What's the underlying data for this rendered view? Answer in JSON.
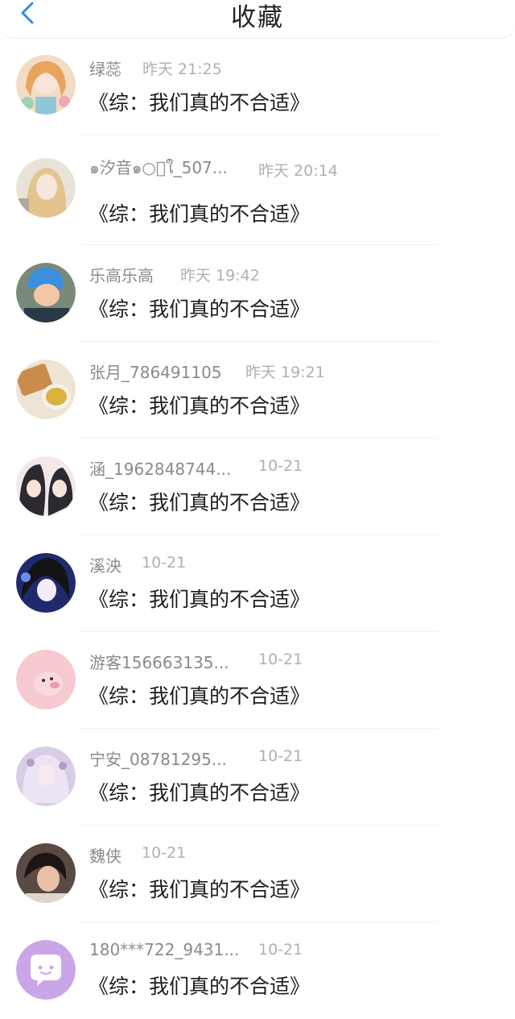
{
  "header": {
    "title": "收藏"
  },
  "colors": {
    "accent": "#2f8cf0",
    "username": "#8a8a8a",
    "time": "#b0b0b0"
  },
  "items": [
    {
      "username": "绿蕊",
      "time": "昨天 21:25",
      "title": "《综：我们真的不合适》",
      "avatar": "anime-girl-flowers"
    },
    {
      "username": "๑汐音๑○ฺใ_507...",
      "time": "昨天 20:14",
      "title": "《综：我们真的不合适》",
      "avatar": "blonde-girl"
    },
    {
      "username": "乐高乐高",
      "time": "昨天 19:42",
      "title": "《综：我们真的不合适》",
      "avatar": "baby-blue-hat"
    },
    {
      "username": "张月_786491105",
      "time": "昨天 19:21",
      "title": "《综：我们真的不合适》",
      "avatar": "tea-and-snack"
    },
    {
      "username": "涵_1962848744...",
      "time": "10-21",
      "title": "《综：我们真的不合适》",
      "avatar": "anime-couple"
    },
    {
      "username": "溪泱",
      "time": "10-21",
      "title": "《综：我们真的不合适》",
      "avatar": "anime-dark-hair"
    },
    {
      "username": "游客156663135...",
      "time": "10-21",
      "title": "《综：我们真的不合适》",
      "avatar": "pink-pig"
    },
    {
      "username": "宁安_08781295...",
      "time": "10-21",
      "title": "《综：我们真的不合适》",
      "avatar": "lace-girl"
    },
    {
      "username": "魏侠",
      "time": "10-21",
      "title": "《综：我们真的不合适》",
      "avatar": "woman-photo"
    },
    {
      "username": "180***722_9431...",
      "time": "10-21",
      "title": "《综：我们真的不合适》",
      "avatar": "default-chat-bubble"
    }
  ]
}
